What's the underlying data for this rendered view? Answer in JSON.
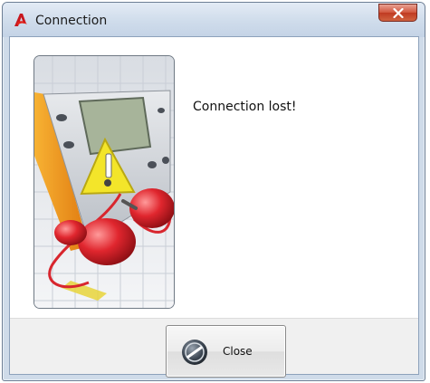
{
  "window": {
    "title": "Connection",
    "app_icon": "acrobat-style-logo-icon",
    "close_icon": "close-x-icon"
  },
  "dialog": {
    "message": "Connection lost!",
    "illustration": "multimeter-with-disconnected-plugs-illustration"
  },
  "buttons": {
    "close_label": "Close",
    "close_icon": "close-disc-icon"
  },
  "colors": {
    "titlebar": "#cfdceb",
    "close_x_red": "#d1553c",
    "meter_orange": "#f29a1b",
    "warning_yellow": "#f3e52a",
    "plug_red": "#d8262e"
  }
}
